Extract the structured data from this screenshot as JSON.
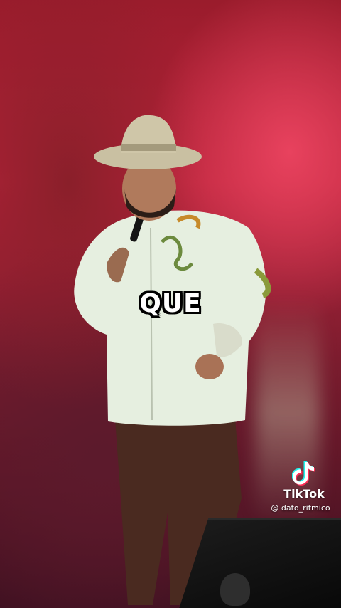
{
  "video": {
    "caption_word": "QUE",
    "watermark": {
      "brand": "TikTok",
      "handle": "@ dato_ritmico",
      "icon": "tiktok-logo-icon"
    },
    "colors": {
      "stage_red": "#b8233a",
      "shirt": "#e6efe0",
      "hat": "#c9c0a2",
      "pants": "#4a2a20"
    }
  }
}
